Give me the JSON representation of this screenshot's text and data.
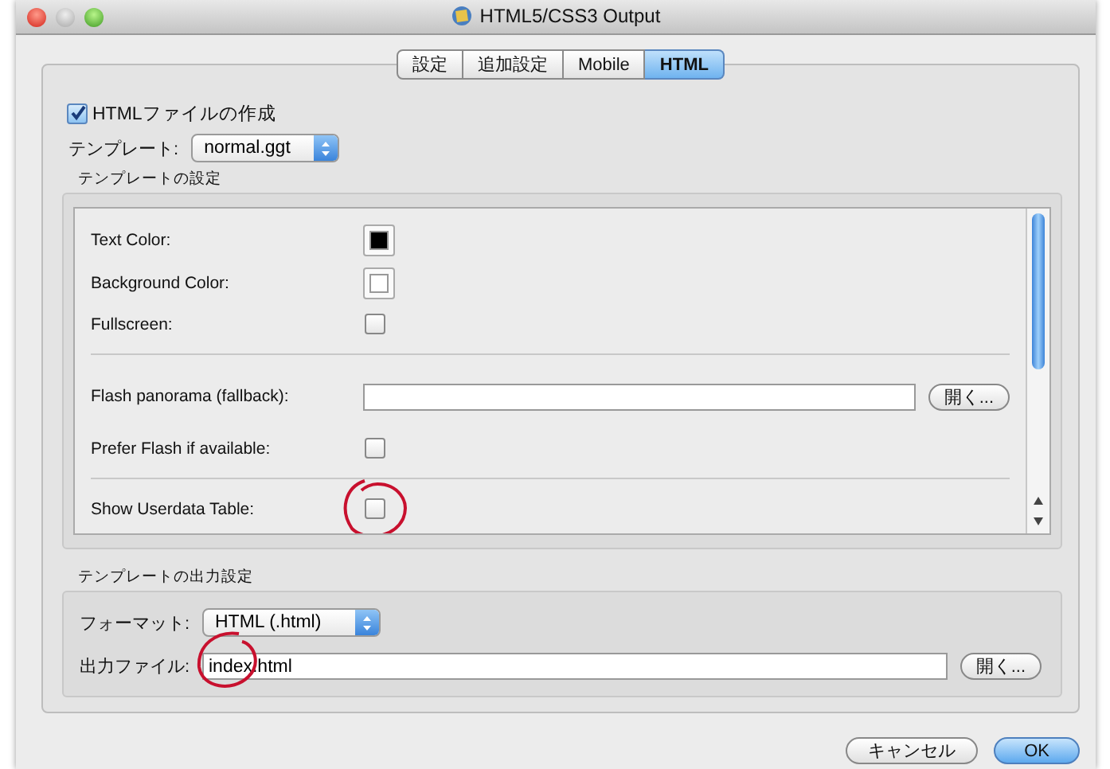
{
  "window": {
    "title": "HTML5/CSS3 Output"
  },
  "tabs": [
    {
      "label": "設定",
      "selected": false
    },
    {
      "label": "追加設定",
      "selected": false
    },
    {
      "label": "Mobile",
      "selected": false
    },
    {
      "label": "HTML",
      "selected": true
    }
  ],
  "create_html": {
    "label": "HTMLファイルの作成",
    "checked": true
  },
  "template": {
    "label": "テンプレート:",
    "value": "normal.ggt"
  },
  "template_settings": {
    "title": "テンプレートの設定",
    "rows": [
      {
        "kind": "color",
        "label": "Text Color:",
        "color": "#000000"
      },
      {
        "kind": "color",
        "label": "Background Color:",
        "color": "#ffffff"
      },
      {
        "kind": "checkbox",
        "label": "Fullscreen:",
        "checked": false
      },
      {
        "kind": "divider"
      },
      {
        "kind": "file",
        "label": "Flash panorama (fallback):",
        "button": "開く..."
      },
      {
        "kind": "checkbox",
        "label": "Prefer Flash if available:",
        "checked": false
      },
      {
        "kind": "divider"
      },
      {
        "kind": "checkbox",
        "label": "Show Userdata Table:",
        "checked": false,
        "circled": true
      }
    ]
  },
  "output_settings": {
    "title": "テンプレートの出力設定",
    "format": {
      "label": "フォーマット:",
      "value": "HTML (.html)"
    },
    "file": {
      "label": "出力ファイル:",
      "value": "index.html",
      "button": "開く...",
      "circled": true
    }
  },
  "buttons": [
    {
      "label": "キャンセル",
      "default": false
    },
    {
      "label": "OK",
      "default": true
    }
  ]
}
